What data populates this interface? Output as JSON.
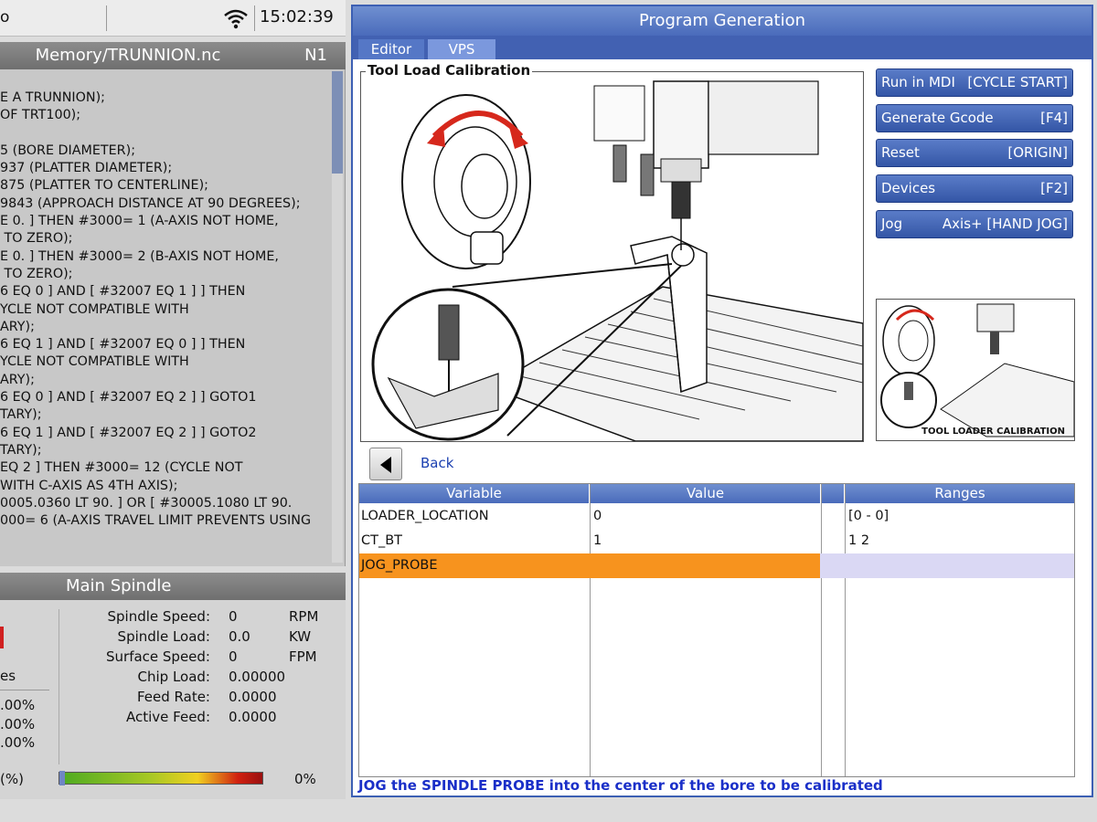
{
  "status_bar": {
    "left_fragment": "o",
    "clock": "15:02:39"
  },
  "program": {
    "title": "Memory/TRUNNION.nc",
    "line_number": "N1",
    "lines": [
      "E A TRUNNION);",
      "OF TRT100);",
      "",
      "5 (BORE DIAMETER);",
      "937 (PLATTER DIAMETER);",
      "875 (PLATTER TO CENTERLINE);",
      "9843 (APPROACH DISTANCE AT 90 DEGREES);",
      "E 0. ] THEN #3000= 1 (A-AXIS NOT HOME,",
      " TO ZERO);",
      "E 0. ] THEN #3000= 2 (B-AXIS NOT HOME,",
      " TO ZERO);",
      "6 EQ 0 ] AND [ #32007 EQ 1 ] ] THEN",
      "YCLE NOT COMPATIBLE WITH",
      "ARY);",
      "6 EQ 1 ] AND [ #32007 EQ 0 ] ] THEN",
      "YCLE NOT COMPATIBLE WITH",
      "ARY);",
      "6 EQ 0 ] AND [ #32007 EQ 2 ] ] GOTO1",
      "TARY);",
      "6 EQ 1 ] AND [ #32007 EQ 2 ] ] GOTO2",
      "TARY);",
      "EQ 2 ] THEN #3000= 12 (CYCLE NOT",
      "WITH C-AXIS AS 4TH AXIS);",
      "0005.0360 LT 90. ] OR [ #30005.1080 LT 90.",
      "000= 6 (A-AXIS TRAVEL LIMIT PREVENTS USING"
    ]
  },
  "spindle": {
    "title": "Main Spindle",
    "left_fragments": {
      "label": "es",
      "p1": ".00%",
      "p2": ".00%",
      "p3": ".00%",
      "load_label": "(%)"
    },
    "rows": [
      {
        "label": "Spindle Speed:",
        "value": "0",
        "unit": "RPM"
      },
      {
        "label": "Spindle Load:",
        "value": "0.0",
        "unit": "KW"
      },
      {
        "label": "Surface Speed:",
        "value": "0",
        "unit": "FPM"
      },
      {
        "label": "Chip Load:",
        "value": "0.00000",
        "unit": ""
      },
      {
        "label": "Feed Rate:",
        "value": "0.0000",
        "unit": ""
      },
      {
        "label": "Active Feed:",
        "value": "0.0000",
        "unit": ""
      }
    ],
    "load_percent": "0%",
    "load_level": 0
  },
  "program_generation": {
    "title": "Program Generation",
    "tabs": {
      "editor": "Editor",
      "vps": "VPS"
    },
    "calibration_title": "Tool Load Calibration",
    "buttons": [
      {
        "left": "Run in MDI",
        "right": "[CYCLE START]"
      },
      {
        "left": "Generate Gcode",
        "right": "[F4]"
      },
      {
        "left": "Reset",
        "right": "[ORIGIN]"
      },
      {
        "left": "Devices",
        "right": "[F2]"
      },
      {
        "left": "Jog",
        "right": "Axis+ [HAND JOG]"
      }
    ],
    "thumbnail_label": "TOOL LOADER CALIBRATION",
    "back_label": "Back",
    "grid": {
      "headers": {
        "variable": "Variable",
        "value": "Value",
        "ranges": "Ranges"
      },
      "rows": [
        {
          "variable": "LOADER_LOCATION",
          "value": "0",
          "range": "[0 - 0]"
        },
        {
          "variable": "CT_BT",
          "value": "1",
          "range": "1 2"
        },
        {
          "variable": "JOG_PROBE",
          "value": "",
          "range": ""
        }
      ]
    },
    "help_text": "JOG the SPINDLE PROBE into the center of the bore to be calibrated"
  },
  "colors": {
    "accent": "#4a6bbb",
    "selected_row": "#f7931e",
    "help_text": "#1a2fc8"
  }
}
